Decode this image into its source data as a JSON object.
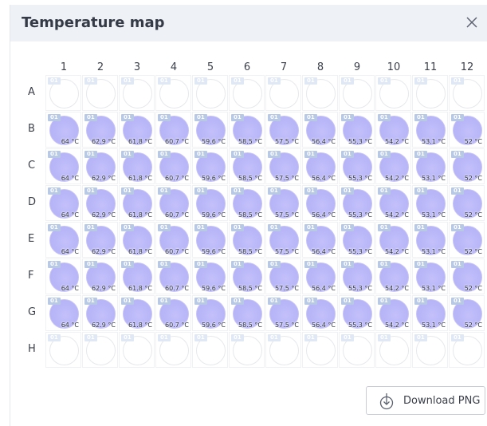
{
  "dialog": {
    "title": "Temperature map",
    "close_icon": "close-icon",
    "download_label": "Download PNG",
    "download_icon": "download-icon"
  },
  "plate": {
    "columns": [
      "1",
      "2",
      "3",
      "4",
      "5",
      "6",
      "7",
      "8",
      "9",
      "10",
      "11",
      "12"
    ],
    "rows": [
      "A",
      "B",
      "C",
      "D",
      "E",
      "F",
      "G",
      "H"
    ],
    "filled_rows": [
      "B",
      "C",
      "D",
      "E",
      "F",
      "G"
    ],
    "well_tag": "01",
    "temperatures": [
      "64 °C",
      "62.9 °C",
      "61.8 °C",
      "60.7 °C",
      "59.6 °C",
      "58.5 °C",
      "57.5 °C",
      "56.4 °C",
      "55.3 °C",
      "54.2 °C",
      "53.1 °C",
      "52 °C"
    ],
    "colors": {
      "filled_well": "#b6b3f7",
      "empty_well": "#ffffff",
      "tag": "#b8c9e6"
    }
  }
}
